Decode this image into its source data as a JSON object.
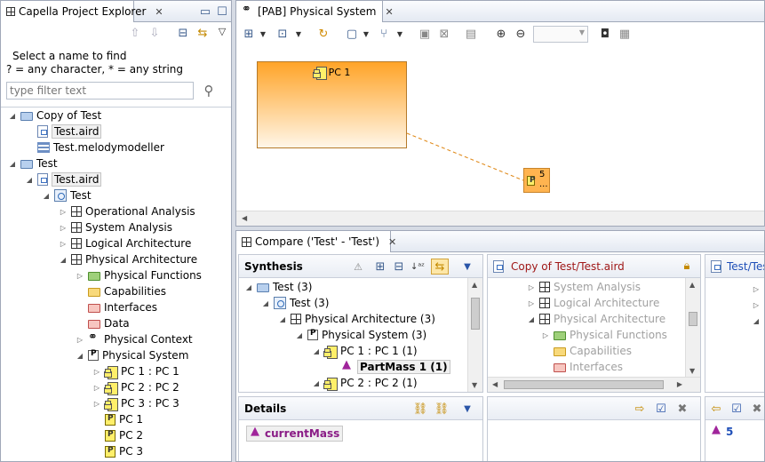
{
  "explorer": {
    "title": "Capella Project Explorer",
    "filter_prompt_line1": "Select a name to find",
    "filter_prompt_line2": "? = any character, * = any string",
    "filter_placeholder": "type filter text",
    "tree": [
      {
        "label": "Copy of Test",
        "icon": "folder-blue-icon",
        "indent": 0,
        "expander": "open"
      },
      {
        "label": "Test.aird",
        "icon": "aird-file-icon",
        "indent": 1,
        "expander": "none",
        "selected": true
      },
      {
        "label": "Test.melodymodeller",
        "icon": "melody-file-icon",
        "indent": 1,
        "expander": "none"
      },
      {
        "label": "Test",
        "icon": "folder-blue-icon",
        "indent": 0,
        "expander": "open"
      },
      {
        "label": "Test.aird",
        "icon": "aird-file-icon",
        "indent": 1,
        "expander": "open",
        "selected": true
      },
      {
        "label": "Test",
        "icon": "model-icon",
        "indent": 2,
        "expander": "open"
      },
      {
        "label": "Operational Analysis",
        "icon": "grid-icon",
        "indent": 3,
        "expander": "closed"
      },
      {
        "label": "System Analysis",
        "icon": "grid-icon",
        "indent": 3,
        "expander": "closed"
      },
      {
        "label": "Logical Architecture",
        "icon": "grid-icon",
        "indent": 3,
        "expander": "closed"
      },
      {
        "label": "Physical Architecture",
        "icon": "grid-icon",
        "indent": 3,
        "expander": "open"
      },
      {
        "label": "Physical Functions",
        "icon": "folder-green-icon",
        "indent": 4,
        "expander": "closed"
      },
      {
        "label": "Capabilities",
        "icon": "folder-yellow-icon",
        "indent": 4,
        "expander": "none"
      },
      {
        "label": "Interfaces",
        "icon": "folder-red-icon",
        "indent": 4,
        "expander": "none"
      },
      {
        "label": "Data",
        "icon": "folder-red-icon",
        "indent": 4,
        "expander": "none"
      },
      {
        "label": "Physical Context",
        "icon": "context-icon",
        "indent": 4,
        "expander": "closed"
      },
      {
        "label": "Physical System",
        "icon": "physical-system-icon",
        "indent": 4,
        "expander": "open"
      },
      {
        "label": "PC 1 : PC 1",
        "icon": "component-icon",
        "indent": 5,
        "expander": "closed"
      },
      {
        "label": "PC 2 : PC 2",
        "icon": "component-icon",
        "indent": 5,
        "expander": "closed"
      },
      {
        "label": "PC 3 : PC 3",
        "icon": "component-icon",
        "indent": 5,
        "expander": "closed"
      },
      {
        "label": "PC 1",
        "icon": "pc-icon",
        "indent": 5,
        "expander": "none"
      },
      {
        "label": "PC 2",
        "icon": "pc-icon",
        "indent": 5,
        "expander": "none"
      },
      {
        "label": "PC 3",
        "icon": "pc-icon",
        "indent": 5,
        "expander": "none"
      }
    ]
  },
  "diagram": {
    "tab_title": "[PAB] Physical System",
    "node_label": "PC 1",
    "port_label": "5",
    "port_sublabel": "..."
  },
  "compare": {
    "tab_title": "Compare ('Test' - 'Test')",
    "synthesis_title": "Synthesis",
    "left_file": "Copy of Test/Test.aird",
    "right_file": "Test/Test",
    "synthesis_tree": [
      {
        "label": "Test (3)",
        "icon": "folder-blue-icon",
        "indent": 0,
        "expander": "open"
      },
      {
        "label": "Test (3)",
        "icon": "model-icon",
        "indent": 1,
        "expander": "open"
      },
      {
        "label": "Physical Architecture (3)",
        "icon": "grid-icon",
        "indent": 2,
        "expander": "open"
      },
      {
        "label": "Physical System (3)",
        "icon": "physical-system-icon",
        "indent": 3,
        "expander": "open"
      },
      {
        "label": "PC 1 : PC 1 (1)",
        "icon": "component-icon",
        "indent": 4,
        "expander": "open"
      },
      {
        "label": "PartMass 1 (1)",
        "icon": "mass-icon",
        "indent": 5,
        "expander": "none",
        "bold": true
      },
      {
        "label": "PC 2 : PC 2 (1)",
        "icon": "component-icon",
        "indent": 4,
        "expander": "open"
      }
    ],
    "left_tree": [
      {
        "label": "System Analysis",
        "icon": "grid-icon",
        "expander": "closed",
        "indent": 0
      },
      {
        "label": "Logical Architecture",
        "icon": "grid-icon",
        "expander": "closed",
        "indent": 0
      },
      {
        "label": "Physical Architecture",
        "icon": "grid-icon",
        "expander": "open",
        "indent": 0
      },
      {
        "label": "Physical Functions",
        "icon": "folder-green-icon",
        "expander": "closed",
        "indent": 1
      },
      {
        "label": "Capabilities",
        "icon": "folder-yellow-icon",
        "expander": "none",
        "indent": 1
      },
      {
        "label": "Interfaces",
        "icon": "folder-red-icon",
        "expander": "none",
        "indent": 1
      }
    ],
    "details_title": "Details",
    "details_item": "currentMass",
    "right_value": "5"
  },
  "colors": {
    "node_top": "#ffa428",
    "node_bottom": "#fff6e8",
    "accent_blue": "#1f4fb8",
    "link_red": "#a01818"
  }
}
